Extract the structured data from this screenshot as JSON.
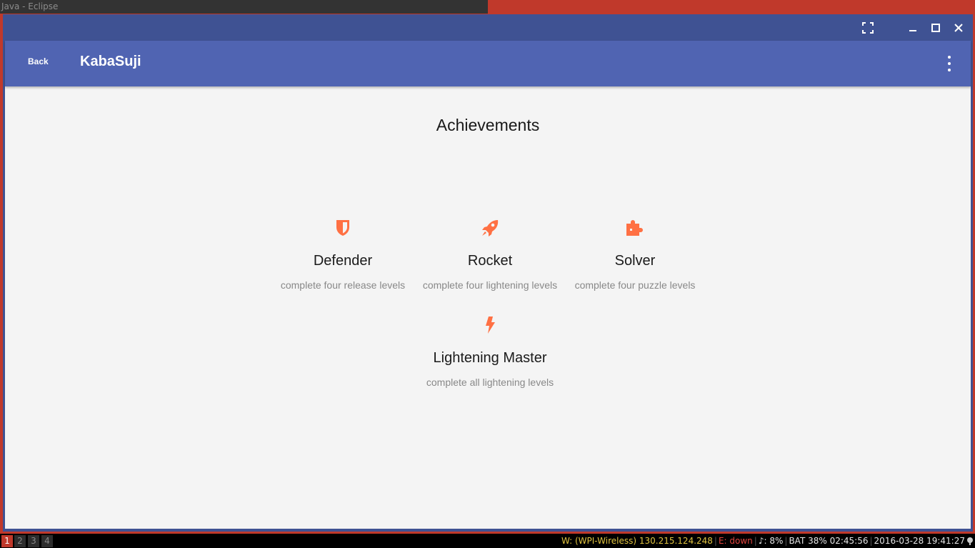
{
  "window_title": "Java - Eclipse",
  "app": {
    "back_label": "Back",
    "title": "KabaSuji"
  },
  "page_title": "Achievements",
  "achievements": [
    {
      "name": "Defender",
      "description": "complete four release levels",
      "icon": "shield-icon"
    },
    {
      "name": "Rocket",
      "description": "complete four lightening levels",
      "icon": "rocket-icon"
    },
    {
      "name": "Solver",
      "description": "complete four puzzle levels",
      "icon": "puzzle-icon"
    },
    {
      "name": "Lightening Master",
      "description": "complete all lightening levels",
      "icon": "lightning-icon"
    }
  ],
  "colors": {
    "accent": "#ff7043",
    "appbar": "#5064b2",
    "window_frame": "#3f5293",
    "content_bg": "#f4f4f4"
  },
  "statusbar": {
    "workspaces": [
      "1",
      "2",
      "3",
      "4"
    ],
    "active_workspace": "1",
    "wifi": "W: (WPI-Wireless) 130.215.124.248",
    "ethernet": "E: down",
    "volume": "♪: 8%",
    "battery": "BAT 38% 02:45:56",
    "datetime": "2016-03-28 19:41:27"
  }
}
